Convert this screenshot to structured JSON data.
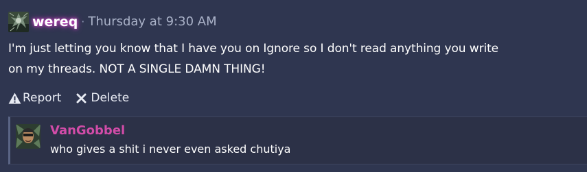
{
  "post": {
    "username": "wereq",
    "separator": "·",
    "timestamp": "Thursday at 9:30 AM",
    "message_line1": "I'm just letting you know that I have you on Ignore so I don't read anything you write",
    "message_line2": "on my threads. NOT A SINGLE DAMN THING!",
    "username_glow_color": "#d84ad0"
  },
  "actions": {
    "report_icon": "warning-icon",
    "report_label": "Report",
    "delete_icon": "close-icon",
    "delete_label": "Delete"
  },
  "reply": {
    "username": "VanGobbel",
    "text": "who gives a shit i never even asked chutiya",
    "username_color": "#d24ca8"
  },
  "colors": {
    "background": "#2f3650",
    "reply_background": "#2c3147",
    "reply_border": "#5a6585",
    "timestamp": "#aab2c8"
  }
}
